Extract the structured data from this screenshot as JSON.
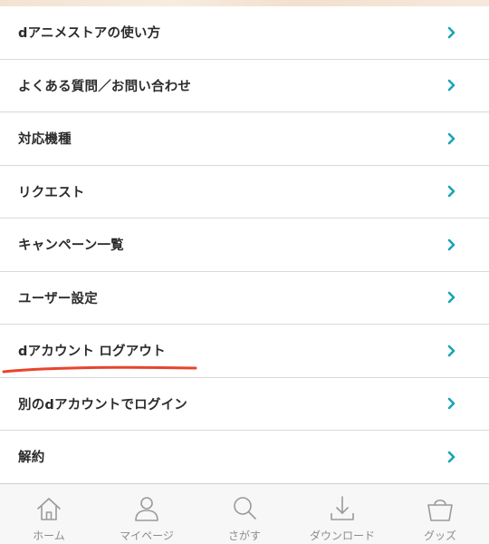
{
  "menu": {
    "items": [
      {
        "label": "dアニメストアの使い方"
      },
      {
        "label": "よくある質問／お問い合わせ"
      },
      {
        "label": "対応機種"
      },
      {
        "label": "リクエスト"
      },
      {
        "label": "キャンペーン一覧"
      },
      {
        "label": "ユーザー設定"
      },
      {
        "label": "dアカウント ログアウト"
      },
      {
        "label": "別のdアカウントでログイン"
      },
      {
        "label": "解約"
      }
    ],
    "chevron_icon": "chevron-right-icon",
    "chevron_color": "#1aa3b8"
  },
  "tabbar": {
    "tabs": [
      {
        "label": "ホーム",
        "icon": "home-icon"
      },
      {
        "label": "マイページ",
        "icon": "person-icon"
      },
      {
        "label": "さがす",
        "icon": "search-icon"
      },
      {
        "label": "ダウンロード",
        "icon": "download-icon"
      },
      {
        "label": "グッズ",
        "icon": "shopping-bag-icon"
      }
    ],
    "icon_color": "#9a9a9a"
  },
  "annotation": {
    "underline_color": "#e8452c"
  }
}
